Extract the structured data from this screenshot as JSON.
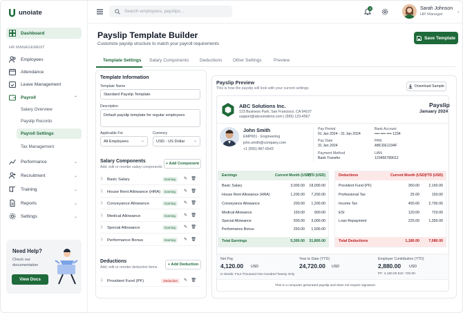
{
  "app": {
    "name": "unoiate"
  },
  "sidebar": {
    "dashboard": "Dashboard",
    "section": "HR MANAGEMENT",
    "items": [
      {
        "label": "Employees"
      },
      {
        "label": "Attendance"
      },
      {
        "label": "Leave Management"
      },
      {
        "label": "Payroll"
      }
    ],
    "payroll_sub": [
      {
        "label": "Salary Overview"
      },
      {
        "label": "Payslip Records"
      },
      {
        "label": "Payroll Settings"
      },
      {
        "label": "Tax Management"
      }
    ],
    "more": [
      {
        "label": "Performance"
      },
      {
        "label": "Recruitment"
      },
      {
        "label": "Training"
      },
      {
        "label": "Reports"
      },
      {
        "label": "Settings"
      }
    ],
    "help": {
      "title": "Need Help?",
      "text": "Check our documentation",
      "button": "View Docs"
    }
  },
  "header": {
    "search_placeholder": "Search employees, payslips...",
    "notif_count": "3",
    "user_name": "Sarah Johnson",
    "user_role": "HR Manager"
  },
  "page": {
    "title": "Payslip Template Builder",
    "subtitle": "Customize payslip structure to match your payroll requirements",
    "save": "Save Template",
    "tabs": [
      "Template Settings",
      "Salary Components",
      "Deductions",
      "Other Settings",
      "Preview"
    ]
  },
  "form": {
    "info_title": "Template Information",
    "name_label": "Template Name",
    "name_value": "Standard Payslip Template",
    "desc_label": "Description",
    "desc_value": "Default payslip template for regular employees",
    "applicable_label": "Applicable For",
    "applicable_value": "All Employees",
    "currency_label": "Currency",
    "currency_value": "USD - US Dollar",
    "salary_title": "Salary Components",
    "salary_sub": "Add, edit or reorder salary components",
    "add_component": "+ Add Component",
    "components": [
      "Basic Salary",
      "House Rent Allowance (HRA)",
      "Conveyance Allowance",
      "Medical Allowance",
      "Special Allowance",
      "Performance Bonus"
    ],
    "earning_tag": "Earning",
    "ded_title": "Deductions",
    "ded_sub": "Add, edit or reorder deduction items",
    "add_deduction": "+ Add Deduction",
    "deductions": [
      "Provident Fund (PF)"
    ],
    "deduction_tag": "Deduction"
  },
  "preview": {
    "title": "Payslip Preview",
    "subtitle": "This is how the payslip will look with your current settings",
    "download": "Download Sample",
    "company": "ABC Solutions Inc.",
    "address": "123 Business Park, San Francisco, CA 94107",
    "contact": "support@abcsolutions.com  |  (555) 123-4567",
    "doc_title": "Payslip",
    "period": "January 2024",
    "emp_name": "John Smith",
    "emp_id": "EMP001 · Engineering",
    "emp_email": "john.smith@company.com",
    "emp_phone": "+1 (555) 987-6543",
    "pay_period_label": "Pay Period",
    "pay_period": "01 Jan 2024 - 31 Jan 2024",
    "pay_date_label": "Pay Date",
    "pay_date": "31 Jan 2024",
    "bank_label": "Bank Account",
    "bank": "•••• •••• •••• 1234",
    "pan_label": "PAN",
    "pan": "ABCDE1234F",
    "method_label": "Payment Method",
    "method": "Bank Transfer",
    "uan_label": "UAN",
    "uan": "123456789012",
    "earnings": {
      "h1": "Earnings",
      "h2": "Current Month (USD)",
      "h3": "YTD (USD)",
      "rows": [
        [
          "Basic Salary",
          "3,000.00",
          "18,000.00"
        ],
        [
          "House Rent Allowance (HRA)",
          "1,200.00",
          "7,200.00"
        ],
        [
          "Conveyance Allowance",
          "200.00",
          "1,200.00"
        ],
        [
          "Medical Allowance",
          "150.00",
          "900.00"
        ],
        [
          "Special Allowance",
          "500.00",
          "3,000.00"
        ],
        [
          "Performance Bonus",
          "250.00",
          "1,500.00"
        ]
      ],
      "total": [
        "Total Earnings",
        "5,300.00",
        "31,800.00"
      ]
    },
    "deductions": {
      "h1": "Deductions",
      "h2": "Current Month (USD)",
      "h3": "YTD (USD)",
      "rows": [
        [
          "Provident Fund (PF)",
          "360.00",
          "2,160.00"
        ],
        [
          "Professional Tax",
          "25.00",
          "150.00"
        ],
        [
          "Income Tax",
          "450.00",
          "2,700.00"
        ],
        [
          "ESI",
          "120.00",
          "720.00"
        ],
        [
          "Loan Repayment",
          "225.00",
          "1,350.00"
        ]
      ],
      "total": [
        "Total Deductions",
        "1,180.00",
        "7,080.00"
      ]
    },
    "net_label": "Net Pay",
    "net_value": "4,120.00",
    "net_cur": "USD",
    "net_words": "In Words: Four Thousand One Hundred Twenty Only",
    "ytd_label": "Year to Date (YTD)",
    "ytd_value": "24,720.00",
    "ytd_cur": "USD",
    "emp_contrib_label": "Employer Contribution (YTD)",
    "emp_contrib_value": "2,880.00",
    "emp_contrib_cur": "USD",
    "emp_contrib_detail": "PF: 2,160.00   ESI: 720.00",
    "footer": "This is a computer generated payslip and does not require signature."
  },
  "colors": {
    "brand": "#1f6a3a",
    "earnings_bg": "#e6f1ea",
    "deductions_bg": "#fde8e8",
    "deduction_text": "#b91c1c"
  }
}
